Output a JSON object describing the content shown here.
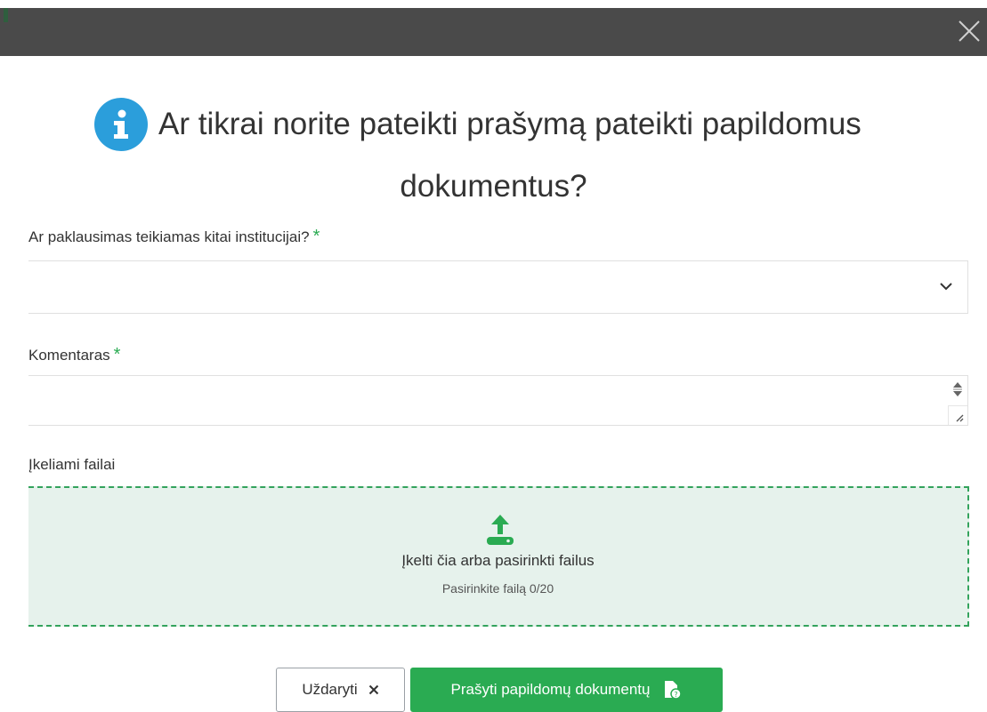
{
  "dialog": {
    "title_line1": "Ar tikrai norite pateikti prašymą pateikti papildomus",
    "title_line2": "dokumentus?"
  },
  "form": {
    "question_label": "Ar paklausimas teikiamas kitai institucijai?",
    "question_value": "",
    "comment_label": "Komentaras",
    "comment_value": "",
    "required_mark": "*",
    "files_label": "Įkeliami failai"
  },
  "upload": {
    "main_text": "Įkelti čia arba pasirinkti failus",
    "sub_text": "Pasirinkite failą 0/20"
  },
  "buttons": {
    "close_label": "Uždaryti",
    "submit_label": "Prašyti papildomų dokumentų"
  },
  "colors": {
    "accent_green": "#2aab52",
    "info_blue": "#2b9edb",
    "topbar": "#4a4a4a"
  },
  "icons": {
    "close": "close-icon",
    "info": "info-icon",
    "chevron": "chevron-down-icon",
    "upload": "upload-icon",
    "submit": "document-question-icon"
  }
}
